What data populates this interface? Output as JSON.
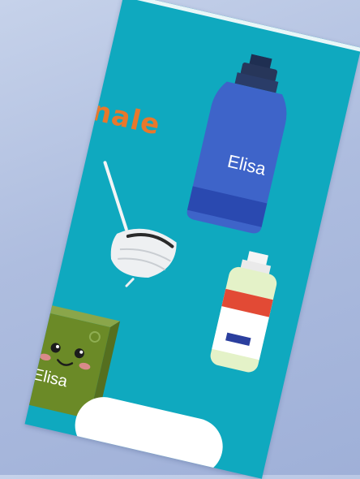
{
  "screen": {
    "heading_fragment": "nale",
    "bottle_label": "Elisa",
    "box_label": "Elisa"
  },
  "icons": [
    "water-bottle-icon",
    "face-mask-icon",
    "hand-sanitizer-icon",
    "juice-box-icon"
  ],
  "colors": {
    "screen_bg": "#0fa9bf",
    "heading": "#e8782c",
    "bottle": "#3e64c9",
    "box": "#6b8a27",
    "sanitizer_cap": "#e24a35"
  }
}
